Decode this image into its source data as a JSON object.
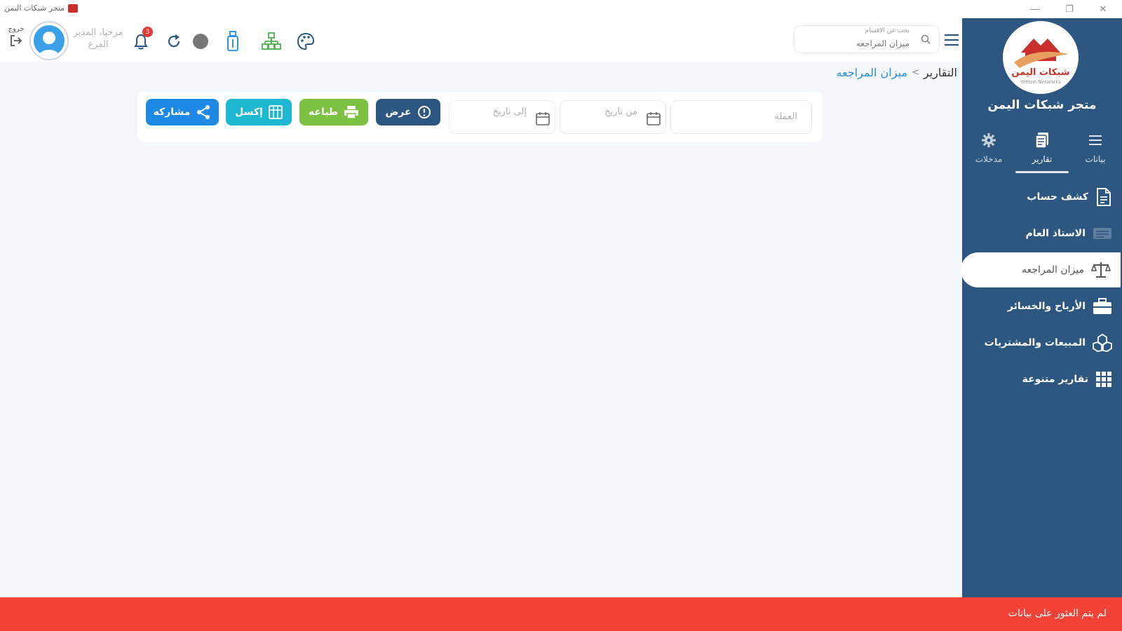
{
  "window": {
    "title": "متجر شبكات اليمن",
    "controls": {
      "minimize": "—",
      "maximize": "❐",
      "close": "✕"
    }
  },
  "topbar": {
    "logout_label": "خروج",
    "greeting_line1": "مرحبا، المدير",
    "greeting_line2": "الفرع",
    "notification_count": "3",
    "search": {
      "hint": "بحث عن الاقسام",
      "value": "ميزان المراجعه"
    },
    "icons": [
      "logout-icon",
      "avatar",
      "bell-icon",
      "refresh-icon",
      "status-dot-icon",
      "usb-icon",
      "network-icon",
      "palette-icon",
      "search-icon",
      "hamburger-icon"
    ]
  },
  "breadcrumb": {
    "root": "التقارير",
    "separator": ">",
    "current": "ميزان المراجعه"
  },
  "filters": {
    "currency_placeholder": "العملة",
    "from_date_placeholder": "من تاريخ",
    "to_date_placeholder": "إلى تاريخ"
  },
  "actions": {
    "view": "عرض",
    "print": "طباعه",
    "excel": "إكسل",
    "share": "مشاركه"
  },
  "sidebar": {
    "store_name": "متجر شبكات اليمن",
    "logo_text": "شبكات اليمن",
    "logo_subtext": "Yemen Networks",
    "tabs": [
      {
        "label": "مدخلات",
        "icon": "gear-icon"
      },
      {
        "label": "تقارير",
        "icon": "reports-icon",
        "active": true
      },
      {
        "label": "بيانات",
        "icon": "list-icon"
      }
    ],
    "menu": [
      {
        "label": "كشف حساب",
        "icon": "document-icon"
      },
      {
        "label": "الاستاذ العام",
        "icon": "ledger-icon"
      },
      {
        "label": "ميزان المراجعه",
        "icon": "scale-icon",
        "active": true
      },
      {
        "label": "الأرباح والخسائر",
        "icon": "briefcase-icon"
      },
      {
        "label": "المبيعات والمشتريات",
        "icon": "boxes-icon"
      },
      {
        "label": "تقارير متنوعة",
        "icon": "grid-icon"
      }
    ]
  },
  "status": {
    "message": "لم يتم العثور على بيانات"
  },
  "colors": {
    "sidebar": "#2d5780",
    "status_bar": "#f44336",
    "view_button": "#2d5780",
    "print_button": "#7cc142",
    "excel_button": "#1fb8d3",
    "share_button": "#1e88e5",
    "link": "#2a8ee0"
  }
}
